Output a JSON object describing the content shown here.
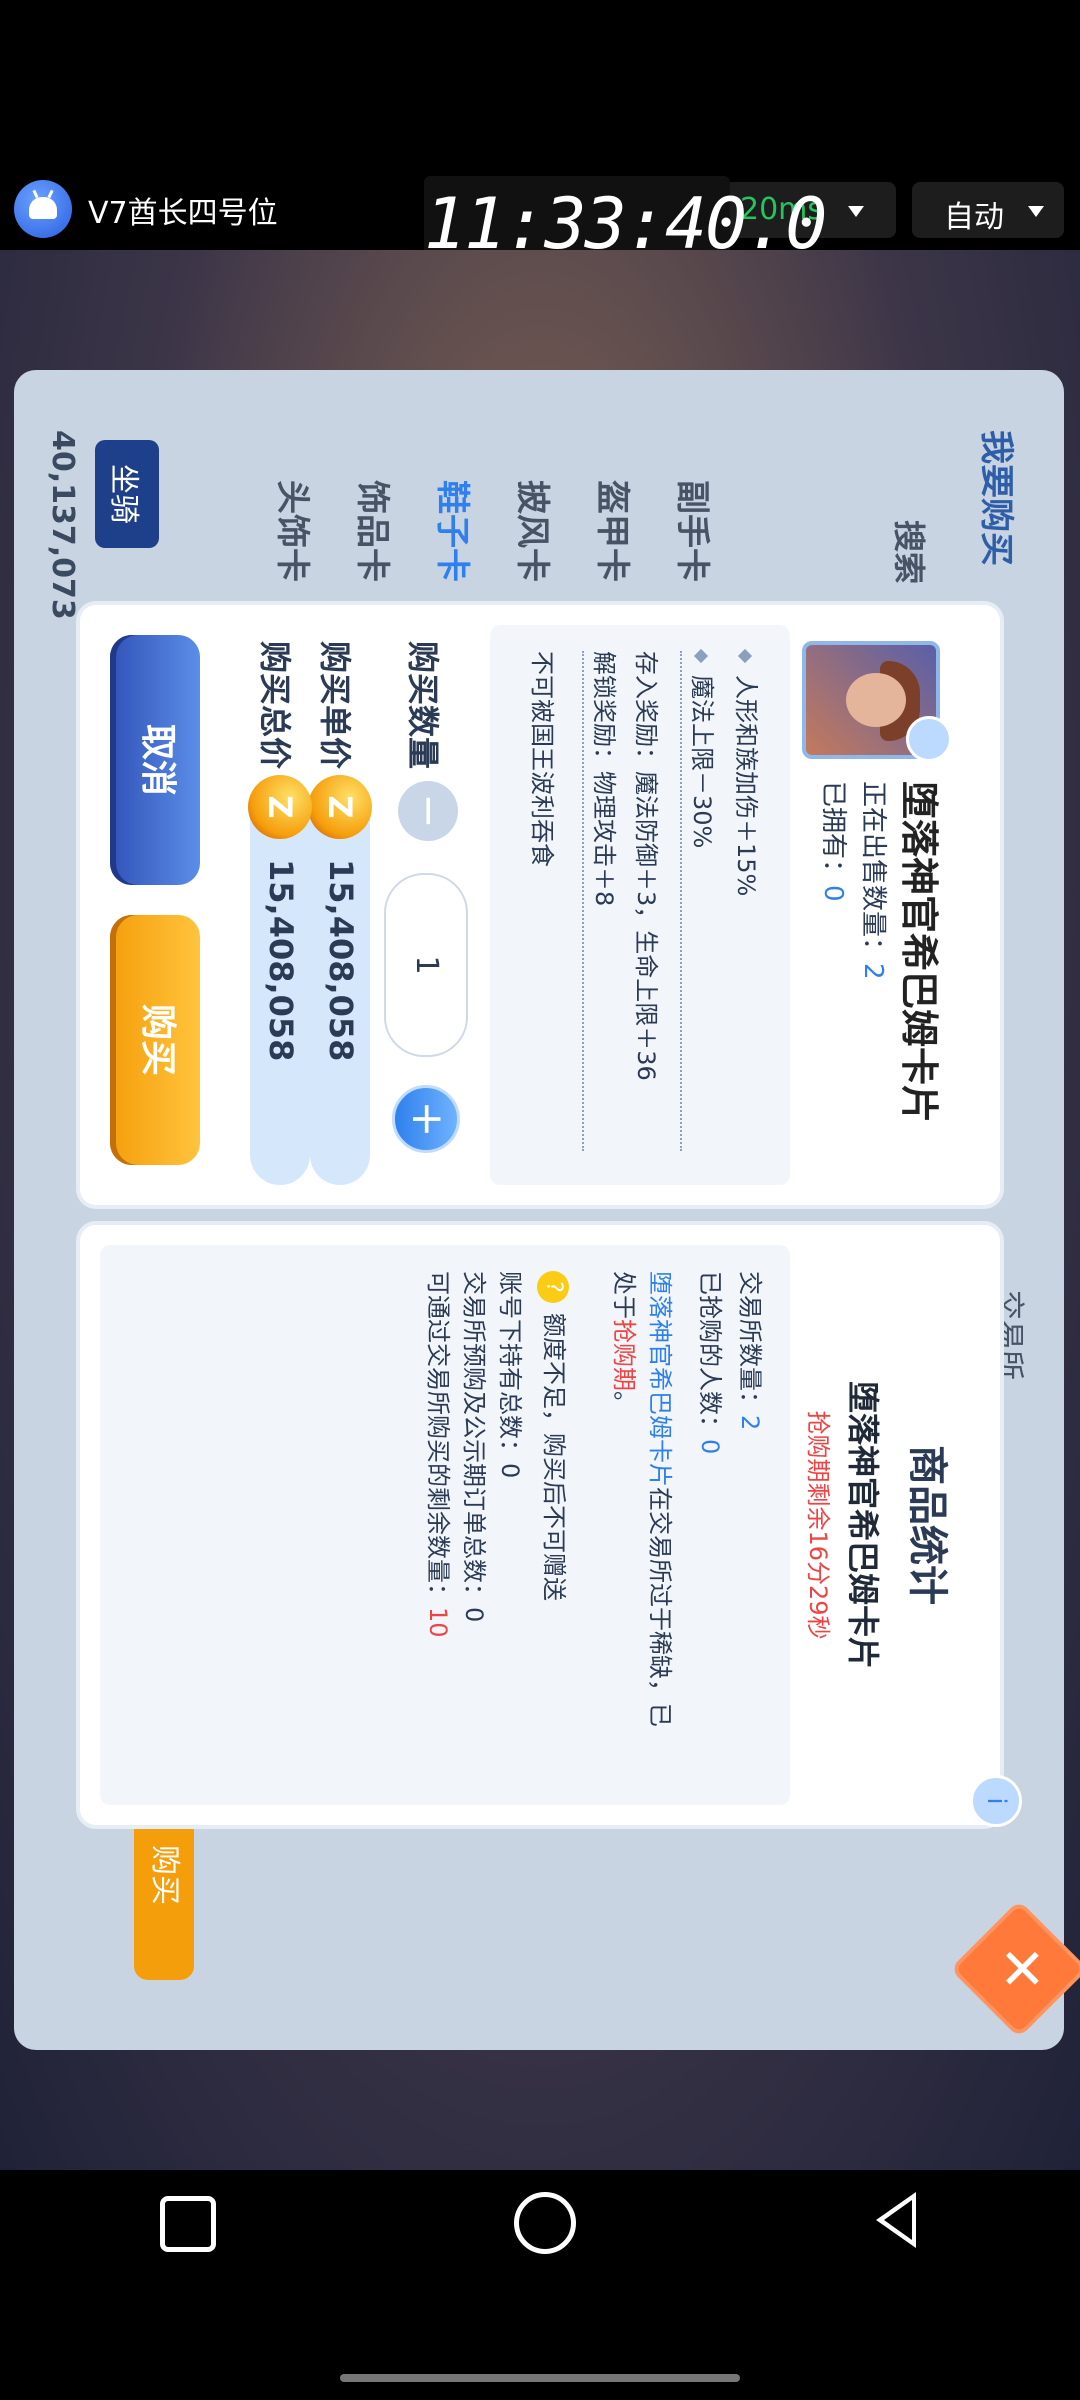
{
  "status_bar": {
    "app_name": "V7酋长四号位",
    "clock": "11:33:40.0",
    "ping": "20ms",
    "mode": "自动"
  },
  "background": {
    "coin_balance": "40,137,073",
    "side_items": [
      "副手卡",
      "盔甲卡",
      "披风卡",
      "鞋子卡",
      "饰品卡",
      "头饰卡"
    ],
    "mount_tab": "坐骑",
    "buy_tab": "我要购买",
    "search": "搜索",
    "exchange_tab": "交易所",
    "bottom_buy": "购买"
  },
  "purchase": {
    "item_name": "堕落神官希巴姆卡片",
    "selling_label": "正在出售数量：",
    "selling_count": "2",
    "owned_label": "已拥有：",
    "owned_count": "0",
    "effects": [
      "人形和族加伤＋15%",
      "魔法上限－30%"
    ],
    "deposit_reward": "存入奖励：魔法防御＋3，生命上限＋36",
    "unlock_reward": "解锁奖励：物理攻击＋8",
    "note": "不可被国王波利吞食",
    "qty_label": "购买数量",
    "quantity": "1",
    "unit_label": "购买单价",
    "unit_price": "15,408,058",
    "total_label": "购买总价",
    "total_price": "15,408,058",
    "coin_symbol": "Z",
    "minus": "−",
    "plus": "+",
    "cancel": "取消",
    "buy": "购买"
  },
  "stats": {
    "title": "商品统计",
    "item_name": "堕落神官希巴姆卡片",
    "countdown": "抢购期剩余16分29秒",
    "exchange_count_label": "交易所数量：",
    "exchange_count": "2",
    "buyers_label": "已抢购的人数：",
    "buyers": "0",
    "scarce_item": "堕落神官希巴姆卡片",
    "scarce_text1": "在交易所过于稀缺，已",
    "scarce_text2": "处于",
    "scarce_status": "抢购期",
    "scarce_end": "。",
    "warning": "额度不足，购买后不可赠送",
    "account_total": "账号下持有总数：0",
    "preorder_total": "交易所预购及公示期订单总数：0",
    "remaining_label": "可通过交易所购买的剩余数量：",
    "remaining": "10",
    "info": "i"
  },
  "colors": {
    "accent_blue": "#2f80ed",
    "accent_red": "#ef4444",
    "buy_orange": "#f59e0b",
    "cancel_blue": "#3153b8"
  }
}
